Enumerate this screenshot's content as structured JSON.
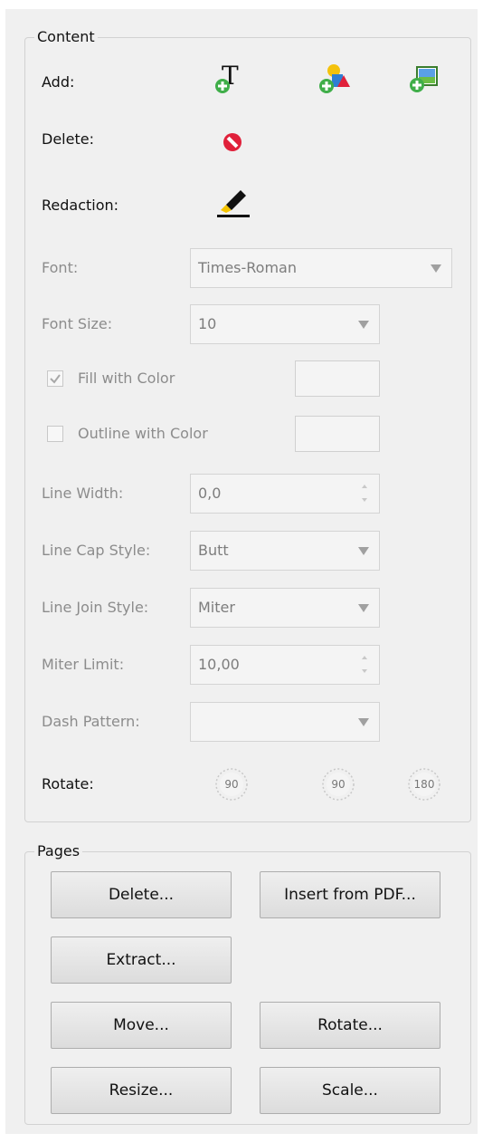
{
  "content": {
    "title": "Content",
    "add_label": "Add:",
    "delete_label": "Delete:",
    "redaction_label": "Redaction:",
    "icons": {
      "add_text": "add-text-icon",
      "add_shape": "add-shape-icon",
      "add_image": "add-image-icon",
      "delete": "delete-icon",
      "redaction": "redaction-marker-icon"
    },
    "font": {
      "label": "Font:",
      "value": "Times-Roman"
    },
    "font_size": {
      "label": "Font Size:",
      "value": "10"
    },
    "fill": {
      "label": "Fill with Color",
      "checked": true
    },
    "outline": {
      "label": "Outline with Color",
      "checked": false
    },
    "line_width": {
      "label": "Line Width:",
      "value": "0,0"
    },
    "line_cap": {
      "label": "Line Cap Style:",
      "value": "Butt"
    },
    "line_join": {
      "label": "Line Join Style:",
      "value": "Miter"
    },
    "miter_limit": {
      "label": "Miter Limit:",
      "value": "10,00"
    },
    "dash_pattern": {
      "label": "Dash Pattern:",
      "value": ""
    },
    "rotate": {
      "label": "Rotate:",
      "dials": [
        "90",
        "90",
        "180"
      ]
    }
  },
  "pages": {
    "title": "Pages",
    "buttons": {
      "delete": "Delete...",
      "insert": "Insert from PDF...",
      "extract": "Extract...",
      "move": "Move...",
      "rotate": "Rotate...",
      "resize": "Resize...",
      "scale": "Scale..."
    }
  },
  "colors": {
    "panel_bg": "#f0f0f0",
    "disabled_text": "#8c8c8c",
    "add_green": "#3fae49",
    "delete_red": "#e0203a",
    "marker_yellow": "#f5c400"
  }
}
